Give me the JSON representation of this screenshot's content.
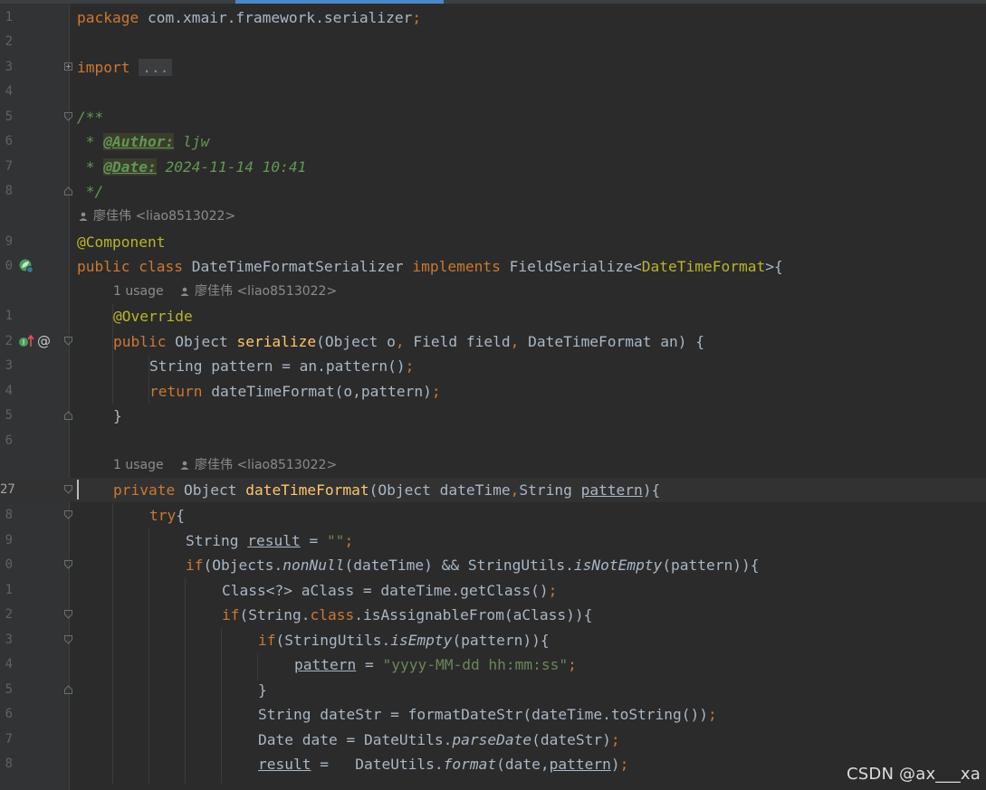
{
  "editor": {
    "file_language": "Java",
    "colors": {
      "background": "#2b2b2b",
      "gutter": "#313335",
      "keyword": "#cc7832",
      "annotation": "#bbb529",
      "method": "#ffc66d",
      "string": "#6a8759",
      "doc_comment": "#629755",
      "plain": "#a9b7c6"
    },
    "line_numbers": {
      "l1": "1",
      "l2": "2",
      "l3": "3",
      "l4": "4",
      "l5": "5",
      "l6": "6",
      "l7": "7",
      "l8": "8",
      "l9": "9",
      "l10": "0",
      "l11": "1",
      "l12": "2",
      "l13": "3",
      "l14": "4",
      "l15": "5",
      "l16": "6",
      "l17": "27",
      "l18": "8",
      "l19": "9",
      "l20": "0",
      "l21": "1",
      "l22": "2",
      "l23": "3",
      "l24": "4",
      "l25": "5",
      "l26": "6",
      "l27": "7",
      "l28": "8"
    },
    "code": {
      "package_kw": "package",
      "package_name": " com.xmair.framework.serializer",
      "semicolon": ";",
      "import_kw": "import",
      "import_collapsed": "...",
      "doc_open": "/**",
      "doc_star": " * ",
      "author_tag": "@Author:",
      "author_value": " ljw",
      "date_tag": "@Date:",
      "date_value": " 2024-11-14 10:41",
      "doc_close": " */",
      "component_ann": "@Component",
      "public_kw": "public",
      "class_kw": " class",
      "class_name": " DateTimeFormatSerializer ",
      "implements_kw": "implements",
      "iface": " FieldSerialize<",
      "iface_generic": "DateTimeFormat",
      "iface_close": ">{",
      "override_ann": "@Override",
      "public_kw2": "public",
      "obj_type": " Object ",
      "serialize_fn": "serialize",
      "serialize_params_a": "(Object o",
      "comma": ",",
      "serialize_params_b": " Field field",
      "serialize_params_c": " DateTimeFormat an) {",
      "pattern_decl": "String pattern = an.pattern()",
      "return_kw": "return",
      "return_expr": " dateTimeFormat(o,pattern)",
      "close_brace": "}",
      "private_kw": "private",
      "obj_type2": " Object ",
      "dtf_fn": "dateTimeFormat",
      "dtf_params_a": "(Object dateTime",
      "dtf_params_b": "String ",
      "dtf_param_pattern": "pattern",
      "dtf_params_c": "){",
      "try_kw": "try",
      "open_brace": "{",
      "string_type": "String ",
      "result_var": "result",
      "assign": " = ",
      "empty_str": "\"\"",
      "if_kw": "if",
      "if1_a": "(Objects.",
      "nonnull": "nonNull",
      "if1_b": "(dateTime) && StringUtils.",
      "isnotempty": "isNotEmpty",
      "if1_c": "(pattern)){",
      "aclass_decl": "Class<?> aClass = dateTime.getClass()",
      "if2_a": "(String.",
      "class_kw2": "class",
      "if2_b": ".isAssignableFrom(aClass)){",
      "if3_a": "(StringUtils.",
      "isempty": "isEmpty",
      "if3_b": "(pattern)){",
      "pattern_var": "pattern",
      "pattern_str": "\"yyyy-MM-dd hh:mm:ss\"",
      "datestr_decl": "String dateStr = formatDateStr(dateTime.toString())",
      "date_decl_a": "Date date = DateUtils.",
      "parsedate": "parseDate",
      "date_decl_b": "(dateStr)",
      "result_assign_b": " =   DateUtils.",
      "format_fn": "format",
      "format_args_a": "(date,",
      "format_args_b": ")"
    },
    "hints": {
      "author_class": "廖佳伟 <liao8513022>",
      "usage_1": "1 usage",
      "author_1": "廖佳伟 <liao8513022>",
      "usage_2": "1 usage",
      "author_2": "廖佳伟 <liao8513022>"
    },
    "gutter_icons": {
      "bean": "spring-bean-icon",
      "implements": "implements-method-icon",
      "override_at": "@"
    }
  },
  "watermark": "CSDN @ax___xa"
}
